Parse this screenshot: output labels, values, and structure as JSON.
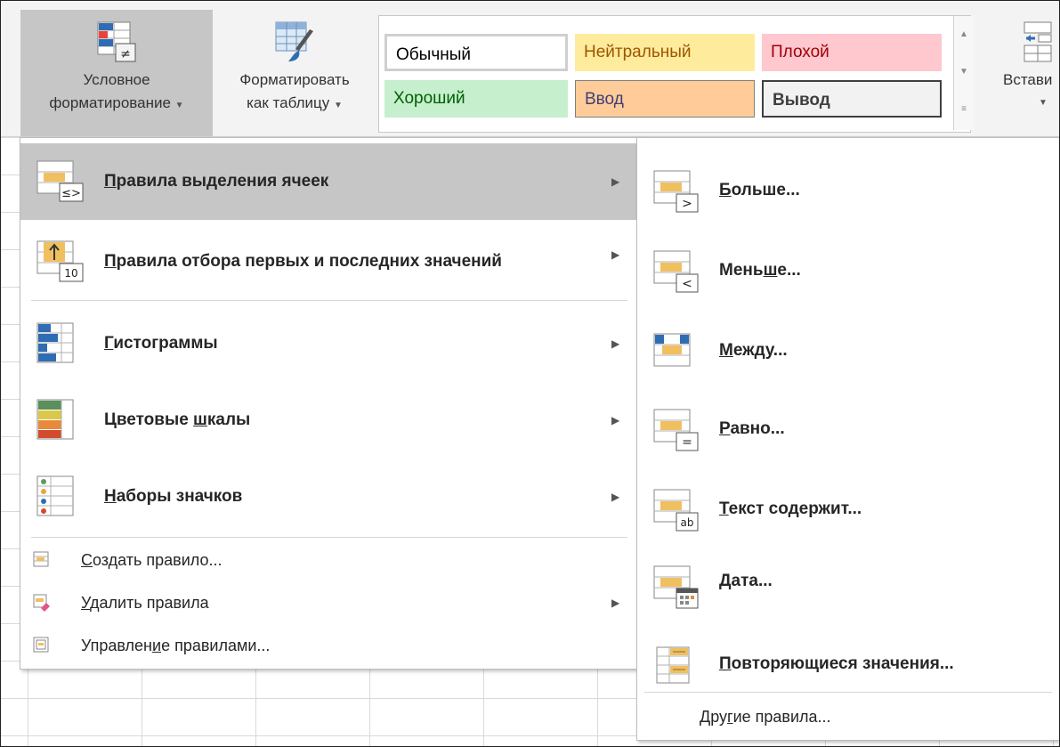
{
  "ribbon": {
    "cond_format": {
      "line1": "Условное",
      "line2": "форматирование"
    },
    "format_table": {
      "line1": "Форматировать",
      "line2": "как таблицу"
    },
    "insert": {
      "label": "Встави"
    },
    "styles": [
      {
        "label": "Обычный",
        "bg": "#ffffff",
        "color": "#000000"
      },
      {
        "label": "Нейтральный",
        "bg": "#ffeb9c",
        "color": "#9c5700"
      },
      {
        "label": "Плохой",
        "bg": "#ffc7ce",
        "color": "#9c0006"
      },
      {
        "label": "Хороший",
        "bg": "#c6efce",
        "color": "#006100"
      },
      {
        "label": "Ввод",
        "bg": "#ffcc99",
        "color": "#3f3f76"
      },
      {
        "label": "Вывод",
        "bg": "#f2f2f2",
        "color": "#3f3f3f"
      }
    ]
  },
  "menu": {
    "items": [
      {
        "pre": "",
        "u": "П",
        "post": "равила выделения ячеек",
        "icon": "highlight-rules-icon"
      },
      {
        "pre": "",
        "u": "П",
        "post": "равила отбора первых и последних значений",
        "icon": "top-bottom-rules-icon"
      },
      {
        "pre": "",
        "u": "Г",
        "post": "истограммы",
        "icon": "data-bars-icon"
      },
      {
        "pre": "Цветовые ",
        "u": "ш",
        "post": "калы",
        "icon": "color-scales-icon"
      },
      {
        "pre": "",
        "u": "Н",
        "post": "аборы значков",
        "icon": "icon-sets-icon"
      }
    ],
    "small_items": [
      {
        "pre": "",
        "u": "С",
        "post": "оздать правило...",
        "icon": "new-rule-icon"
      },
      {
        "pre": "",
        "u": "У",
        "post": "далить правила",
        "icon": "clear-rules-icon"
      },
      {
        "pre": "Управлен",
        "u": "и",
        "post": "е правилами...",
        "icon": "manage-rules-icon"
      }
    ]
  },
  "submenu": {
    "items": [
      {
        "pre": "",
        "u": "Б",
        "post": "ольше...",
        "icon": "greater-than-icon"
      },
      {
        "pre": "Мень",
        "u": "ш",
        "post": "е...",
        "icon": "less-than-icon"
      },
      {
        "pre": "",
        "u": "М",
        "post": "ежду...",
        "icon": "between-icon"
      },
      {
        "pre": "",
        "u": "Р",
        "post": "авно...",
        "icon": "equal-to-icon"
      },
      {
        "pre": "",
        "u": "Т",
        "post": "екст содержит...",
        "icon": "text-contains-icon"
      },
      {
        "pre": "",
        "u": "Д",
        "post": "ата...",
        "icon": "date-occurring-icon"
      },
      {
        "pre": "",
        "u": "П",
        "post": "овторяющиеся значения...",
        "icon": "duplicate-values-icon"
      }
    ],
    "other": {
      "pre": "Дру",
      "u": "г",
      "post": "ие правила..."
    }
  },
  "colors": {
    "hover": "#c6c6c6",
    "accent_yellow": "#f0c060",
    "accent_blue": "#2e6db4"
  }
}
